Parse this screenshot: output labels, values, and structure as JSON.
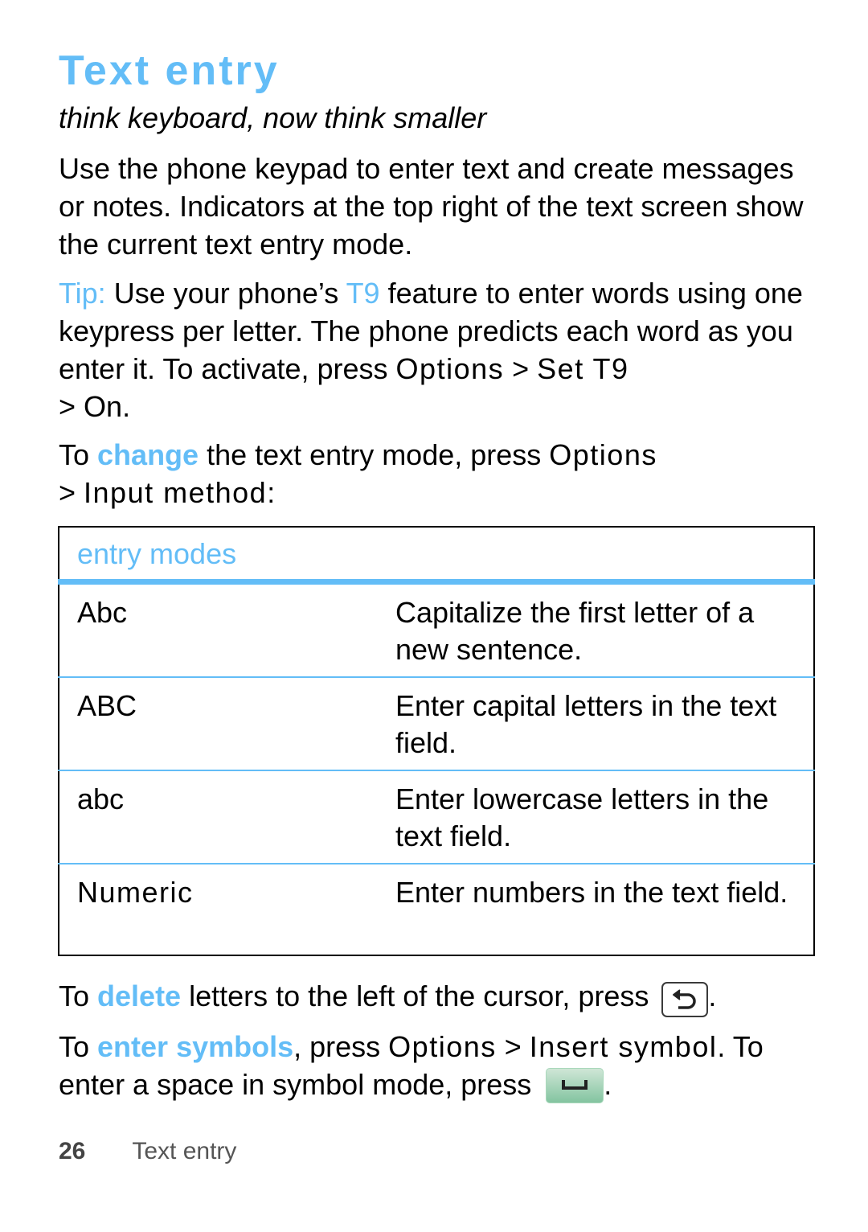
{
  "header": {
    "title": "Text entry",
    "subtitle": "think keyboard, now think smaller"
  },
  "intro": "Use the phone keypad to enter text and create messages or notes. Indicators at the top right of the text screen show the current text entry mode.",
  "tip": {
    "label": "Tip:",
    "text1": " Use your phone’s ",
    "t9": "T9",
    "text2": " feature to enter words using one keypress per letter. The phone predicts each word as you enter it. To activate, press ",
    "menu1": "Options",
    "sep1": " > ",
    "menu2": "Set T9",
    "sep2": " > ",
    "menu3": "On",
    "end": "."
  },
  "change": {
    "prefix": "To ",
    "keyword": "change",
    "text": " the text entry mode, press ",
    "menu1": "Options",
    "sep": " > ",
    "menu2": "Input method",
    "end": ":"
  },
  "table": {
    "header": "entry modes",
    "rows": [
      {
        "mode": "Abc",
        "description": "Capitalize the first letter of a new sentence."
      },
      {
        "mode": "ABC",
        "description": "Enter capital letters in the text field."
      },
      {
        "mode": "abc",
        "description": "Enter lowercase letters in the text field."
      },
      {
        "mode": "Numeric",
        "description": "Enter numbers in the text field."
      }
    ]
  },
  "delete": {
    "prefix": "To ",
    "keyword": "delete",
    "text": " letters to the left of the cursor, press ",
    "key_icon": "back-key-icon",
    "end": "."
  },
  "symbols": {
    "prefix": "To ",
    "keyword": "enter symbols",
    "text1": ", press ",
    "menu1": "Options",
    "sep": " > ",
    "menu2": "Insert symbol",
    "text2": ". To enter a space in symbol mode, press ",
    "key_icon": "space-key-icon",
    "end": "."
  },
  "footer": {
    "page_number": "26",
    "section": "Text entry"
  },
  "colors": {
    "accent": "#63BDF7",
    "space_key": "#9fd1b3"
  }
}
